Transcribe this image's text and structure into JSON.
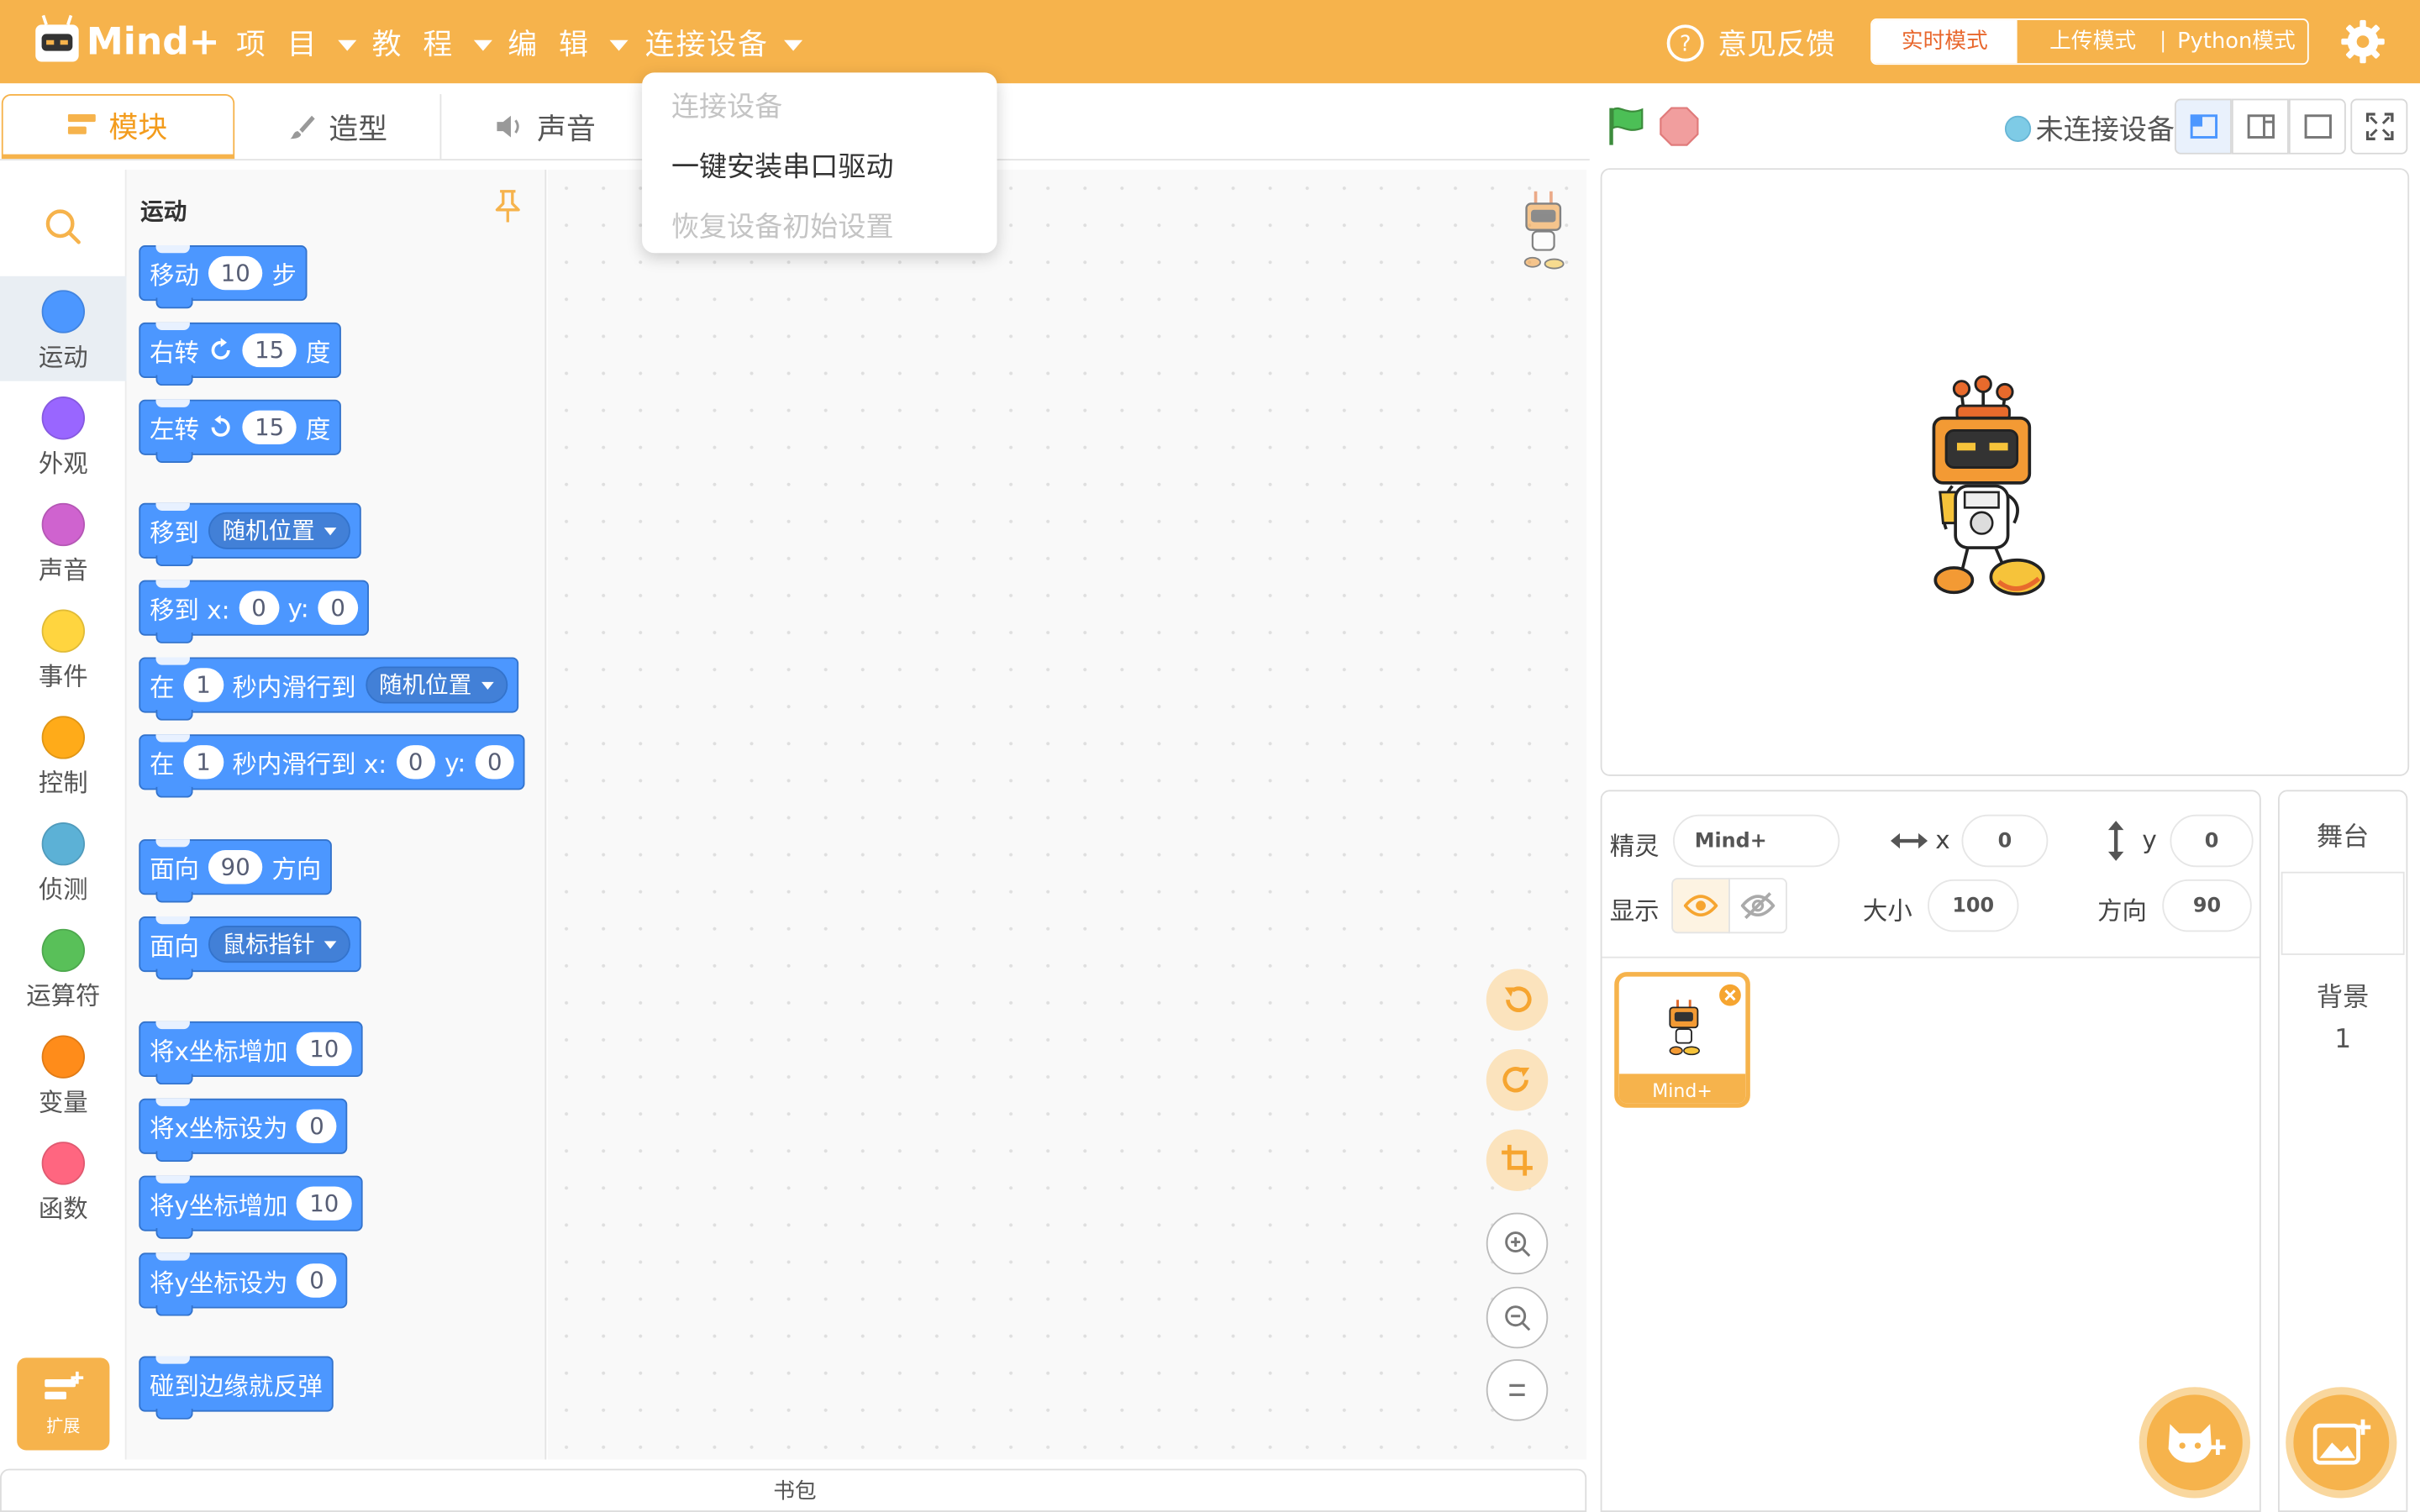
{
  "topbar": {
    "logo_text": "Mind+",
    "menus": [
      "项 目",
      "教 程",
      "编 辑",
      "连接设备"
    ],
    "feedback": "意见反馈",
    "modes": [
      "实时模式",
      "上传模式",
      "Python模式"
    ]
  },
  "tabs": [
    "模块",
    "造型",
    "声音"
  ],
  "connect_menu": {
    "items": [
      "连接设备",
      "一键安装串口驱动",
      "恢复设备初始设置"
    ]
  },
  "categories": [
    {
      "label": "运动",
      "color": "#4c97ff"
    },
    {
      "label": "外观",
      "color": "#9966ff"
    },
    {
      "label": "声音",
      "color": "#cf63cf"
    },
    {
      "label": "事件",
      "color": "#ffd53f"
    },
    {
      "label": "控制",
      "color": "#ffab19"
    },
    {
      "label": "侦测",
      "color": "#5cb1d6"
    },
    {
      "label": "运算符",
      "color": "#59c059"
    },
    {
      "label": "变量",
      "color": "#ff8c1a"
    },
    {
      "label": "函数",
      "color": "#ff6680"
    }
  ],
  "extension_label": "扩展",
  "palette": {
    "section_title": "运动",
    "blocks": {
      "move": {
        "a": "移动",
        "v": "10",
        "b": "步"
      },
      "turn_right": {
        "a": "右转",
        "v": "15",
        "b": "度"
      },
      "turn_left": {
        "a": "左转",
        "v": "15",
        "b": "度"
      },
      "goto": {
        "a": "移到",
        "dd": "随机位置"
      },
      "goto_xy": {
        "a": "移到 x:",
        "x": "0",
        "b": "y:",
        "y": "0"
      },
      "glide": {
        "a": "在",
        "v": "1",
        "b": "秒内滑行到",
        "dd": "随机位置"
      },
      "glide_xy": {
        "a": "在",
        "v": "1",
        "b": "秒内滑行到 x:",
        "x": "0",
        "c": "y:",
        "y": "0"
      },
      "point_dir": {
        "a": "面向",
        "v": "90",
        "b": "方向"
      },
      "point_to": {
        "a": "面向",
        "dd": "鼠标指针"
      },
      "change_x": {
        "a": "将x坐标增加",
        "v": "10"
      },
      "set_x": {
        "a": "将x坐标设为",
        "v": "0"
      },
      "change_y": {
        "a": "将y坐标增加",
        "v": "10"
      },
      "set_y": {
        "a": "将y坐标设为",
        "v": "0"
      },
      "bounce": {
        "a": "碰到边缘就反弹"
      }
    }
  },
  "stage_header": {
    "device_status": "未连接设备"
  },
  "sprite_info": {
    "sprite_label": "精灵",
    "sprite_name": "Mind+",
    "x_label": "x",
    "x_value": "0",
    "y_label": "y",
    "y_value": "0",
    "show_label": "显示",
    "size_label": "大小",
    "size_value": "100",
    "direction_label": "方向",
    "direction_value": "90"
  },
  "sprite_list": [
    {
      "name": "Mind+"
    }
  ],
  "stage_panel": {
    "title": "舞台",
    "backdrop_label": "背景",
    "backdrop_count": "1"
  },
  "backpack_label": "书包",
  "colors": {
    "accent": "#f6b34c",
    "motion_block": "#4c97ff",
    "flag": "#4cbf56",
    "stop": "#ec5959"
  }
}
